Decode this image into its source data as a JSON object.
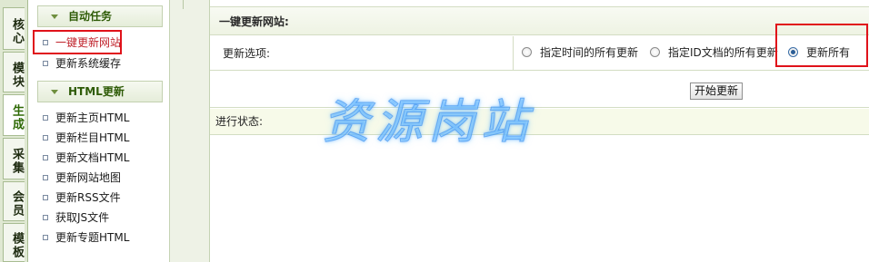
{
  "tabs": [
    {
      "label": "核心",
      "active": false
    },
    {
      "label": "模块",
      "active": false
    },
    {
      "label": "生成",
      "active": true
    },
    {
      "label": "采集",
      "active": false
    },
    {
      "label": "会员",
      "active": false
    },
    {
      "label": "模板",
      "active": false
    }
  ],
  "menu": {
    "groups": [
      {
        "title": "自动任务",
        "items": [
          "一键更新网站",
          "更新系统缓存"
        ]
      },
      {
        "title": "HTML更新",
        "items": [
          "更新主页HTML",
          "更新栏目HTML",
          "更新文档HTML",
          "更新网站地图",
          "更新RSS文件",
          "获取JS文件",
          "更新专题HTML"
        ]
      }
    ],
    "current_item": "一键更新网站"
  },
  "main": {
    "title": "一键更新网站:",
    "options_label": "更新选项:",
    "options": [
      {
        "label": "指定时间的所有更新",
        "selected": false
      },
      {
        "label": "指定ID文档的所有更新",
        "selected": false
      },
      {
        "label": "更新所有",
        "selected": true
      }
    ],
    "start_button": "开始更新",
    "status_label": "进行状态:"
  },
  "watermark": "资源岗站",
  "colors": {
    "highlight_box": "#e0121a",
    "current_item": "#c0232c",
    "group_title": "#2e5b07",
    "status_row_bg": "#f7fae9"
  }
}
